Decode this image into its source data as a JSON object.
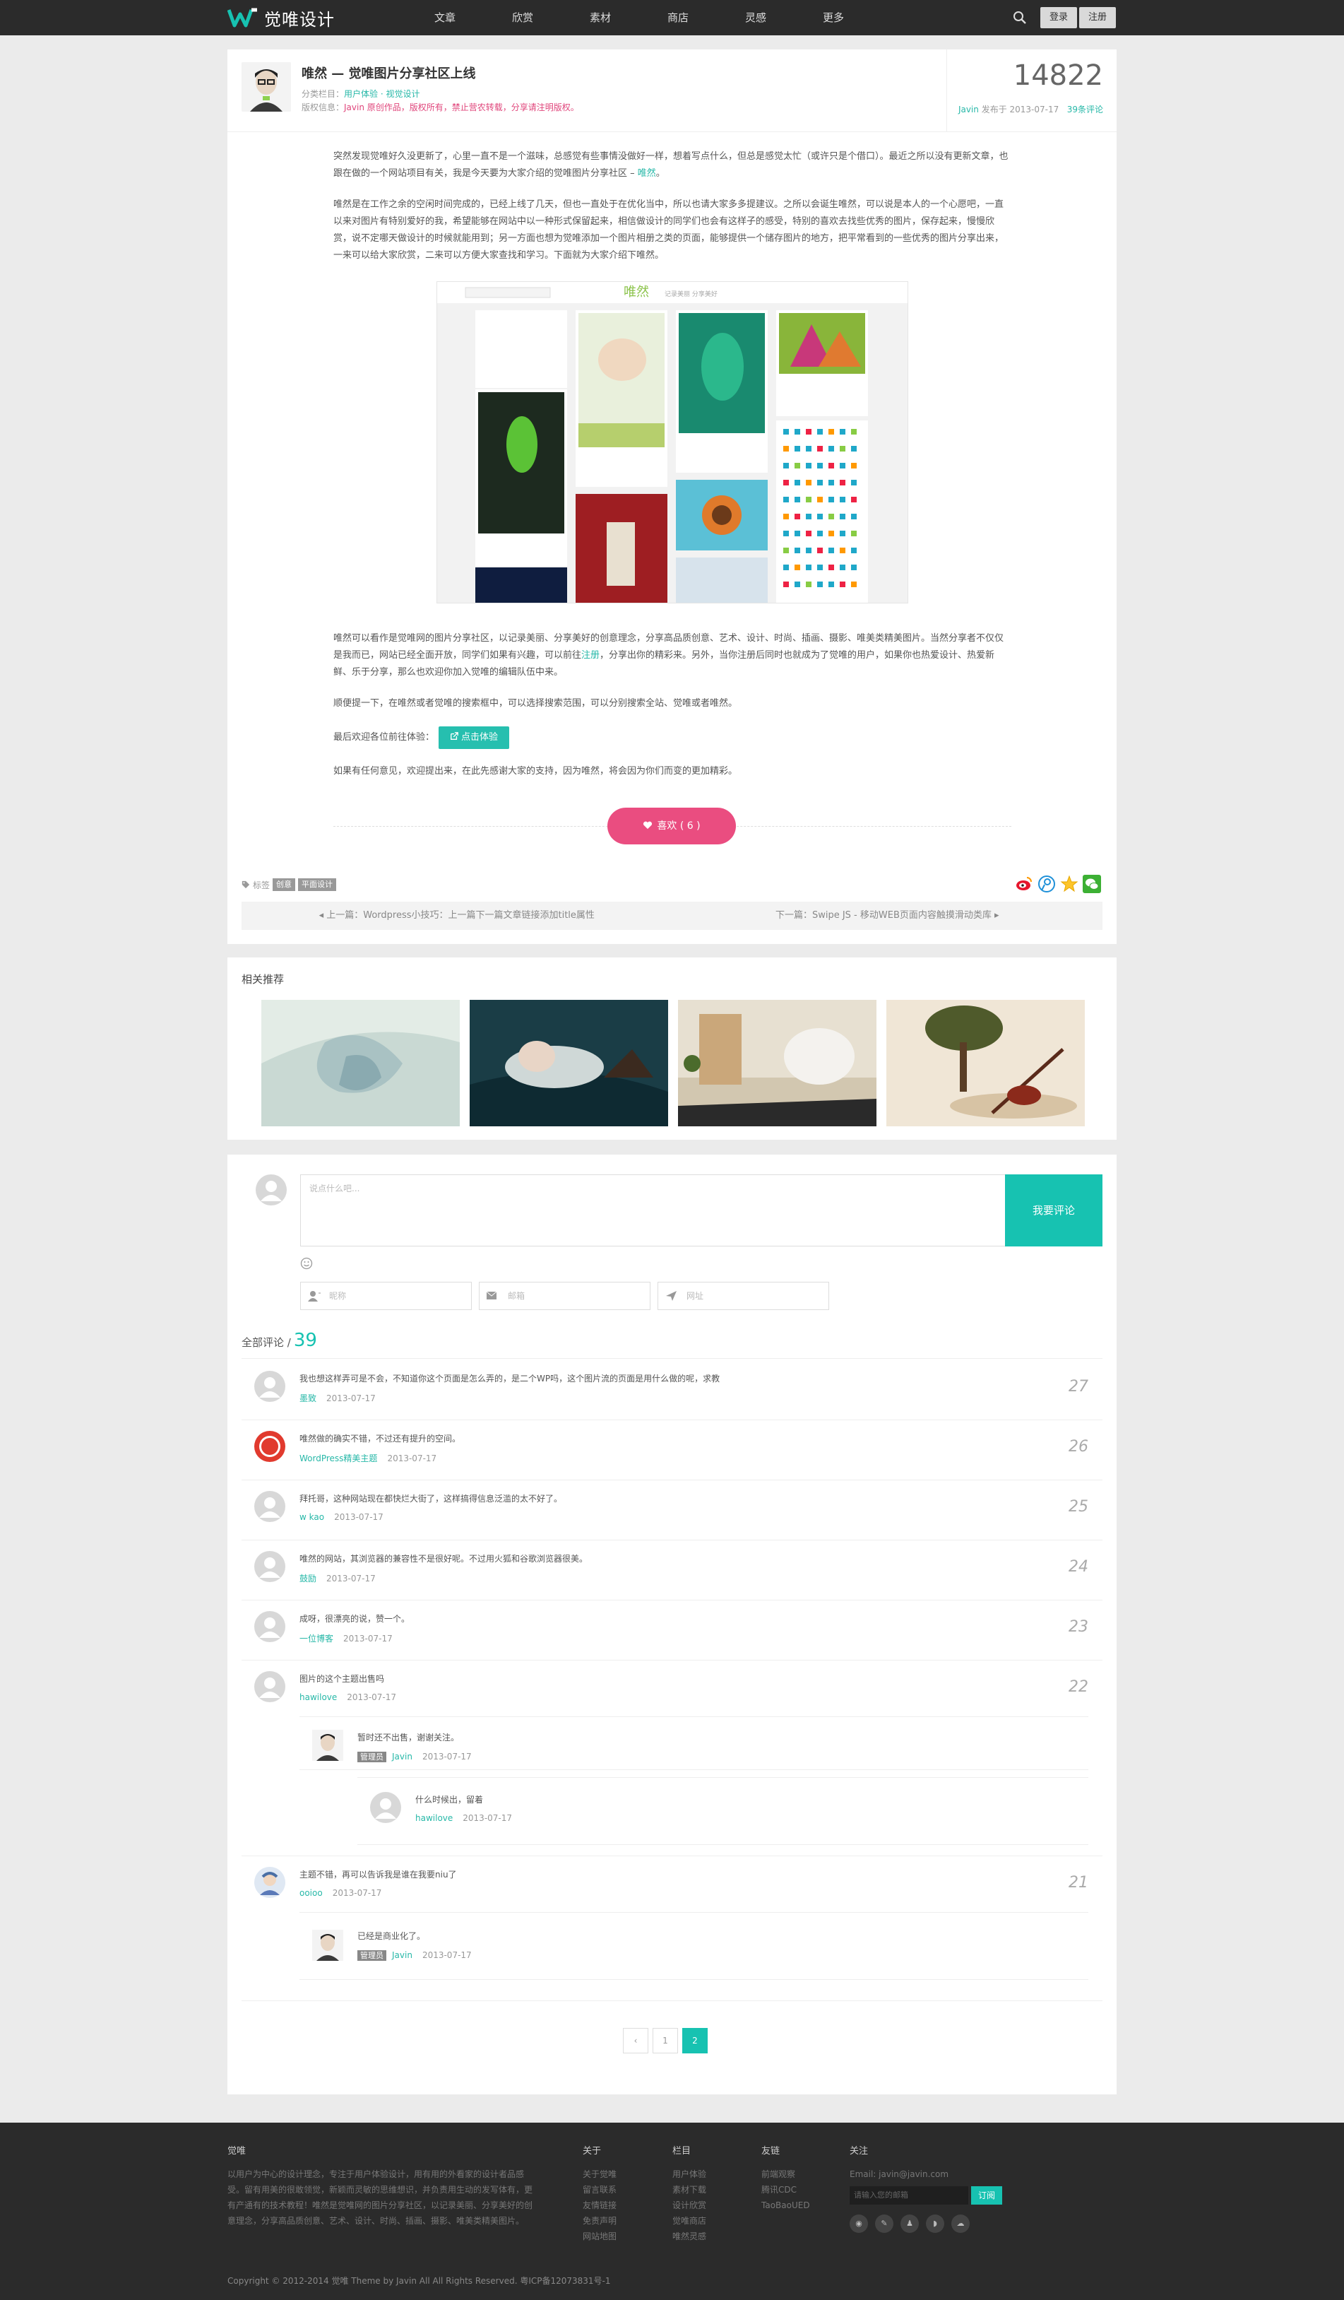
{
  "header": {
    "logo_text": "觉唯设计",
    "nav": [
      "文章",
      "欣赏",
      "素材",
      "商店",
      "灵感",
      "更多"
    ],
    "login_label": "登录",
    "register_label": "注册"
  },
  "article": {
    "title": "唯然 — 觉唯图片分享社区上线",
    "meta_category_prefix": "分类栏目：",
    "meta_categories": "用户体验 · 视觉设计",
    "meta_copyright_prefix": "版权信息：",
    "meta_copyright": "Javin 原创作品，版权所有，禁止营农转载，分享请注明版权。",
    "views": "14822",
    "author": "Javin",
    "posted_prefix": " 发布于 ",
    "date": "2013-07-17",
    "comment_count": "39条评论",
    "paragraphs": [
      "突然发现觉唯好久没更新了，心里一直不是一个滋味，总感觉有些事情没做好一样，想着写点什么，但总是感觉太忙（或许只是个借口）。最近之所以没有更新文章，也跟在做的一个网站项目有关，我是今天要为大家介绍的觉唯图片分享社区 –",
      "唯然是在工作之余的空闲时间完成的，已经上线了几天，但也一直处于在优化当中，所以也请大家多多提建议。之所以会诞生唯然，可以说是本人的一个心愿吧，一直以来对图片有特别爱好的我，希望能够在网站中以一种形式保留起来，相信做设计的同学们也会有这样子的感受，特别的喜欢去找些优秀的图片，保存起来，慢慢欣赏，说不定哪天做设计的时候就能用到；另一方面也想为觉唯添加一个图片相册之类的页面，能够提供一个储存图片的地方，把平常看到的一些优秀的图片分享出来，一来可以给大家欣赏，二来可以方便大家查找和学习。下面就为大家介绍下唯然。",
      "唯然可以看作是觉唯网的图片分享社区，以记录美丽、分享美好的创意理念，分享高品质创意、艺术、设计、时尚、插画、摄影、唯美类精美图片。当然分享者不仅仅是我而已，网站已经全面开放，同学们如果有兴趣，可以前往",
      "顺便提一下，在唯然或者觉唯的搜索框中，可以选择搜索范围，可以分别搜索全站、觉唯或者唯然。",
      "最后欢迎各位前往体验：",
      "如果有任何意见，欢迎提出来，在此先感谢大家的支持，因为唯然，将会因为你们而变的更加精彩。"
    ],
    "link_weiran": "唯然",
    "link_register": "注册",
    "p3_after_link": "，分享出你的精彩来。另外，当你注册后同时也就成为了觉唯的用户，如果你也热爱设计、热爱新鲜、乐于分享，那么也欢迎你加入觉唯的编辑队伍中来。",
    "try_label": "点击体验",
    "like_label": "喜欢 ( 6 )",
    "tags_label": "标签",
    "tags": [
      "创意",
      "平面设计"
    ],
    "prev_post": "上一篇：Wordpress小技巧：上一篇下一篇文章链接添加title属性",
    "next_post": "下一篇：Swipe JS - 移动WEB页面内容触摸滑动类库",
    "screenshot": {
      "logo": "唯然",
      "tagline": "记录美丽 分享美好"
    }
  },
  "related": {
    "title": "相关推荐"
  },
  "comment_form": {
    "placeholder": "说点什么吧...",
    "submit_label": "我要评论",
    "name_placeholder": "昵称",
    "email_placeholder": "邮箱",
    "url_placeholder": "网址"
  },
  "comments_header": {
    "label": "全部评论 /",
    "count": "39"
  },
  "comments": [
    {
      "text": "我也想这样弄可是不会，不知道你这个页面是怎么弄的，是二个WP吗，这个图片流的页面是用什么做的呢，求教",
      "user": "墨致",
      "date": "2013-07-17",
      "num": "27"
    },
    {
      "text": "唯然做的确实不错，不过还有提升的空间。",
      "user": "WordPress精美主题",
      "date": "2013-07-17",
      "num": "26"
    },
    {
      "text": "拜托哥，这种网站现在都快烂大街了，这样搞得信息泛滥的太不好了。",
      "user": "w kao",
      "date": "2013-07-17",
      "num": "25"
    },
    {
      "text": "唯然的网站，其浏览器的兼容性不是很好呢。不过用火狐和谷歌浏览器很美。",
      "user": "鼓励",
      "date": "2013-07-17",
      "num": "24"
    },
    {
      "text": "成呀，很漂亮的说，赞一个。",
      "user": "一位博客",
      "date": "2013-07-17",
      "num": "23"
    },
    {
      "text": "图片的这个主题出售吗",
      "user": "hawilove",
      "date": "2013-07-17",
      "num": "22"
    },
    {
      "text": "主题不错，再可以告诉我是谁在我要niu了",
      "user": "ooioo",
      "date": "2013-07-17",
      "num": "21"
    }
  ],
  "replies": {
    "r1": {
      "text": "暂时还不出售，谢谢关注。",
      "badge": "管理员",
      "user": "Javin",
      "date": "2013-07-17"
    },
    "r2": {
      "text": "什么时候出，留着",
      "user": "hawilove",
      "date": "2013-07-17"
    },
    "r3": {
      "text": "已经是商业化了。",
      "badge": "管理员",
      "user": "Javin",
      "date": "2013-07-17"
    }
  },
  "pager": [
    "1",
    "2"
  ],
  "footer": {
    "about_title": "觉唯",
    "about_text": "以用户为中心的设计理念，专注于用户体验设计，用有用的外看家的设计者品感受。留有用美的很敢领觉，新颖而灵敏的思维想识，并负责用生动的发写体有，更有产通有的技术教程！唯然是觉唯网的图片分享社区，以记录美丽、分享美好的创意理念，分享高品质创意、艺术、设计、时尚、插画、摄影、唯美类精美图片。",
    "col_about_title": "关于",
    "col_about": [
      "关于觉唯",
      "留言联系",
      "友情链接",
      "免责声明",
      "网站地图"
    ],
    "col_cat_title": "栏目",
    "col_cat": [
      "用户体验",
      "素材下载",
      "设计欣赏",
      "觉唯商店",
      "唯然灵感"
    ],
    "col_links_title": "友链",
    "col_links": [
      "前端观察",
      "腾讯CDC",
      "TaoBaoUED"
    ],
    "col_follow_title": "关注",
    "email": "Email: javin@javin.com",
    "subscribe_placeholder": "请输入您的邮箱",
    "subscribe_label": "订阅",
    "copyright": "Copyright © 2012-2014 觉唯 Theme by Javin All All Rights Reserved. 粤ICP备12073831号-1"
  },
  "colors": {
    "accent": "#17c2b1",
    "like": "#ea4d80",
    "topbar": "#2b2b2b",
    "background": "#ebebeb"
  }
}
